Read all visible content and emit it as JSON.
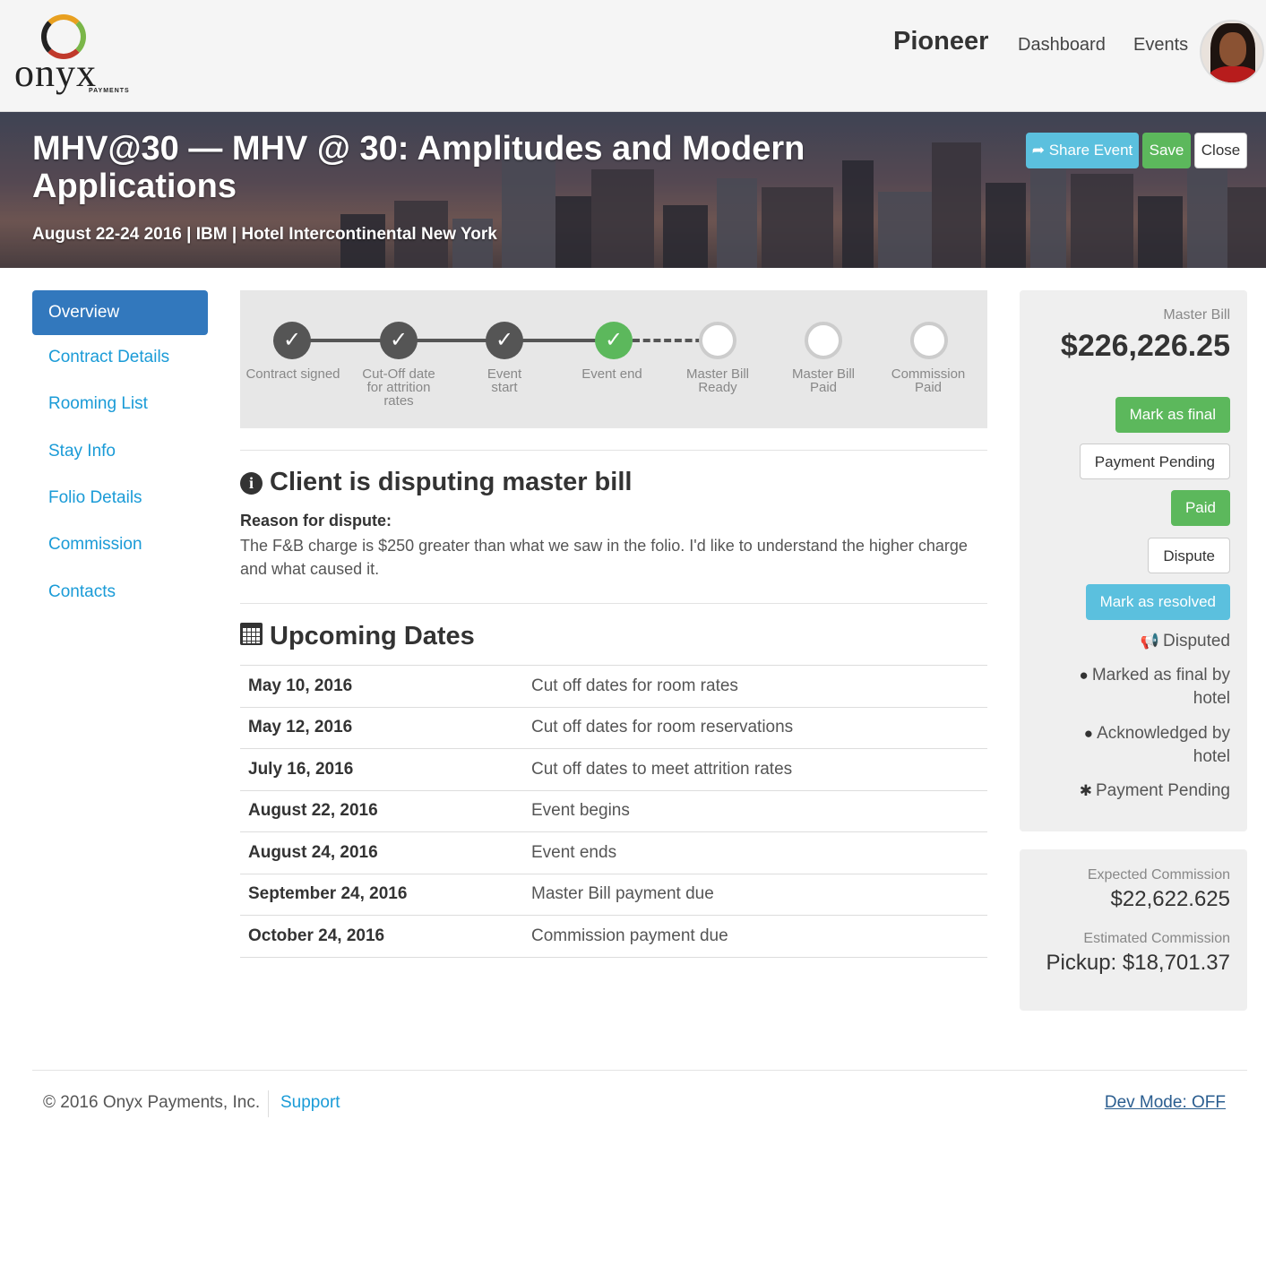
{
  "header": {
    "logo_word": "onyx",
    "logo_sub": "PAYMENTS",
    "brand": "Pioneer",
    "nav": [
      "Dashboard",
      "Events"
    ]
  },
  "event": {
    "title": "MHV@30 — MHV @ 30: Amplitudes and Modern Applications",
    "subtitle": "August 22-24 2016 | IBM | Hotel Intercontinental New York",
    "share_label": "Share Event",
    "save_label": "Save",
    "close_label": "Close"
  },
  "sidebar": {
    "items": [
      "Overview",
      "Contract Details",
      "Rooming List",
      "Stay Info",
      "Folio Details",
      "Commission",
      "Contacts"
    ],
    "active": "Overview"
  },
  "progress": {
    "steps": [
      {
        "label": "Contract signed",
        "state": "done"
      },
      {
        "label": "Cut-Off date for attrition rates",
        "state": "done"
      },
      {
        "label": "Event start",
        "state": "done"
      },
      {
        "label": "Event end",
        "state": "current"
      },
      {
        "label": "Master Bill Ready",
        "state": "pending"
      },
      {
        "label": "Master Bill Paid",
        "state": "pending"
      },
      {
        "label": "Commission Paid",
        "state": "pending"
      }
    ]
  },
  "dispute": {
    "heading": "Client is disputing master bill",
    "reason_label": "Reason for dispute:",
    "reason_text": "The F&B charge is $250 greater than what we saw in the folio. I'd like to understand the higher charge and what caused it."
  },
  "upcoming": {
    "heading": "Upcoming Dates",
    "rows": [
      {
        "date": "May 10, 2016",
        "event": "Cut off dates for room rates"
      },
      {
        "date": "May 12, 2016",
        "event": "Cut off dates for room reservations"
      },
      {
        "date": "July 16, 2016",
        "event": "Cut off dates to meet attrition rates"
      },
      {
        "date": "August 22, 2016",
        "event": "Event begins"
      },
      {
        "date": "August 24, 2016",
        "event": "Event ends"
      },
      {
        "date": "September 24, 2016",
        "event": "Master Bill payment due"
      },
      {
        "date": "October 24, 2016",
        "event": "Commission payment due"
      }
    ]
  },
  "master_bill": {
    "label": "Master Bill",
    "amount": "$226,226.25",
    "buttons": {
      "mark_final": "Mark as final",
      "payment_pending": "Payment Pending",
      "paid": "Paid",
      "dispute": "Dispute",
      "mark_resolved": "Mark as resolved"
    },
    "statuses": [
      {
        "icon": "bullhorn-icon",
        "text": "Disputed"
      },
      {
        "icon": "comment-icon",
        "text": "Marked as final by hotel"
      },
      {
        "icon": "comment-icon",
        "text": "Acknowledged by hotel"
      },
      {
        "icon": "asterisk-icon",
        "text": "Payment Pending"
      }
    ]
  },
  "commission": {
    "expected_label": "Expected Commission",
    "expected_value": "$22,622.625",
    "estimated_label": "Estimated Commission",
    "estimated_value": "Pickup: $18,701.37"
  },
  "footer": {
    "copyright": "© 2016 Onyx Payments, Inc.",
    "support": "Support",
    "dev_mode": "Dev Mode: OFF"
  },
  "colors": {
    "primary": "#3278bd",
    "success": "#5cb85c",
    "info": "#5bc0de",
    "link": "#1a9bd7"
  }
}
